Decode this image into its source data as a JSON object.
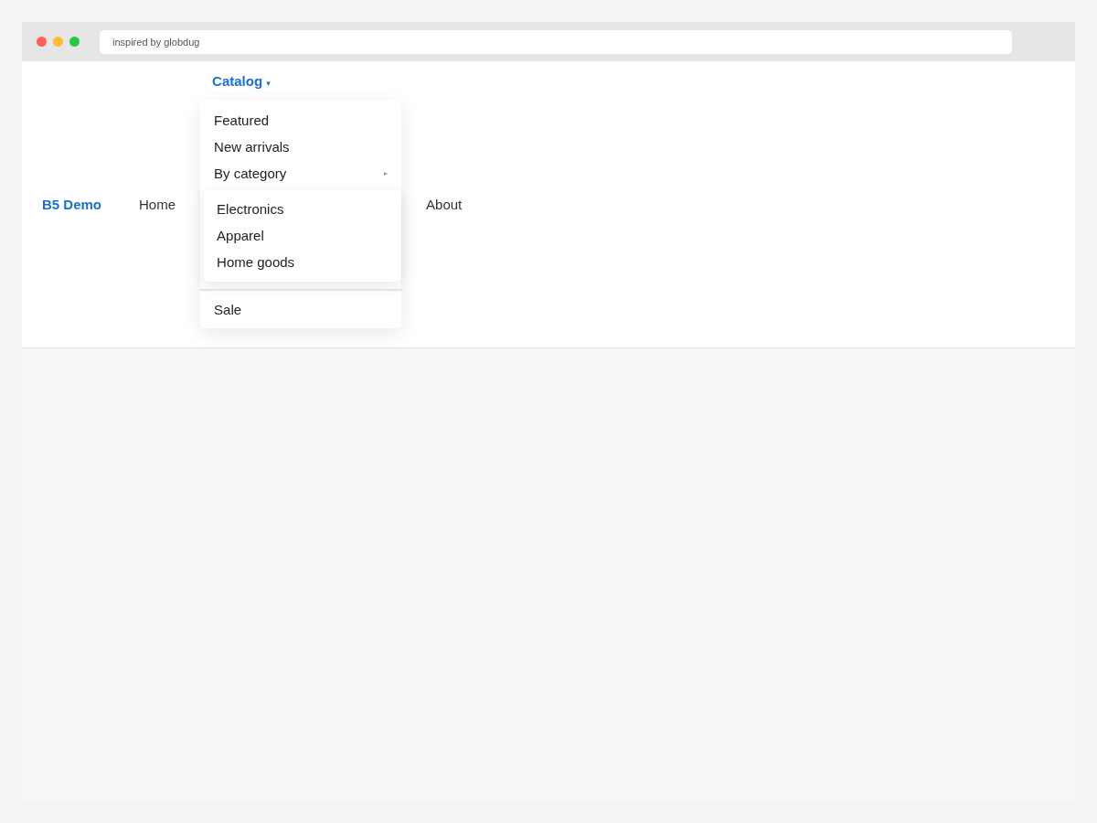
{
  "browser": {
    "address": "inspired by globdug"
  },
  "navbar": {
    "brand": "B5 Demo",
    "items": [
      {
        "kind": "link",
        "label": "Home"
      },
      {
        "kind": "dropdown",
        "label": "Catalog",
        "caret": "▾",
        "expanded": true,
        "menu": [
          {
            "kind": "item",
            "label": "Featured"
          },
          {
            "kind": "item",
            "label": "New arrivals"
          },
          {
            "kind": "submenu",
            "label": "By category",
            "arrow": "▸",
            "expanded": true,
            "children": [
              {
                "label": "Electronics"
              },
              {
                "label": "Apparel"
              },
              {
                "label": "Home goods"
              }
            ]
          },
          {
            "kind": "divider"
          },
          {
            "kind": "item",
            "label": "Sale"
          }
        ]
      },
      {
        "kind": "link",
        "label": "About"
      }
    ]
  }
}
